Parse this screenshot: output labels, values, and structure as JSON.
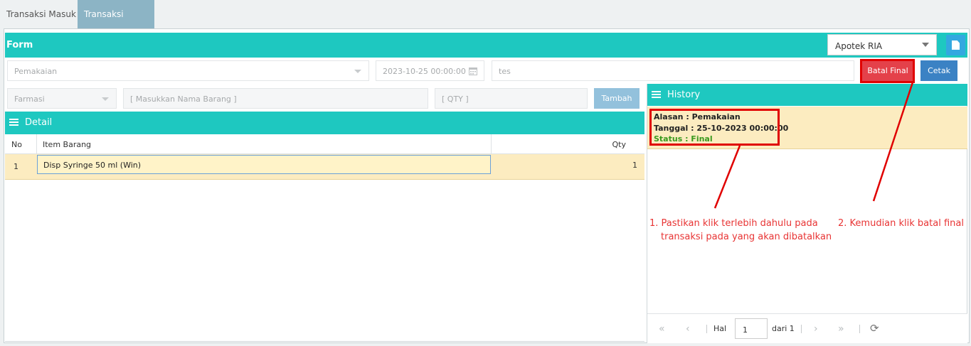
{
  "tabs": [
    {
      "label": "Transaksi Masuk",
      "active": false
    },
    {
      "label": "Transaksi Keluar",
      "active": true
    }
  ],
  "form": {
    "title": "Form",
    "store_select": "Apotek RIA",
    "alasan_placeholder": "Pemakaian",
    "tanggal_value": "2023-10-25 00:00:00",
    "keterangan_value": "tes",
    "batal_final_label": "Batal Final",
    "cetak_label": "Cetak"
  },
  "add_item": {
    "kategori_placeholder": "Farmasi",
    "barang_placeholder": "[ Masukkan Nama Barang ]",
    "qty_placeholder": "[ QTY ]",
    "tambah_label": "Tambah"
  },
  "detail": {
    "title": "Detail",
    "columns": [
      "No",
      "Item Barang",
      "Qty"
    ],
    "rows": [
      {
        "no": "1",
        "item": "Disp Syringe 50 ml (Win)",
        "qty": "1"
      }
    ]
  },
  "history": {
    "title": "History",
    "entries": [
      {
        "alasan": "Alasan : Pemakaian",
        "tanggal": "Tanggal : 25-10-2023 00:00:00",
        "status": "Status : Final"
      }
    ],
    "pager": {
      "hal_label": "Hal",
      "page": "1",
      "of_label": "dari 1"
    }
  },
  "annotations": {
    "note1_line1": "1. Pastikan klik terlebih dahulu pada",
    "note1_line2": "transaksi pada yang akan dibatalkan",
    "note2": "2. Kemudian klik batal final",
    "color": "#e83434"
  },
  "colors": {
    "teal": "#1ec8c0",
    "red_button": "#e4414a",
    "blue_button": "#3b82c4",
    "row_highlight": "#fcecc0",
    "status_green": "#3a9a1e"
  }
}
